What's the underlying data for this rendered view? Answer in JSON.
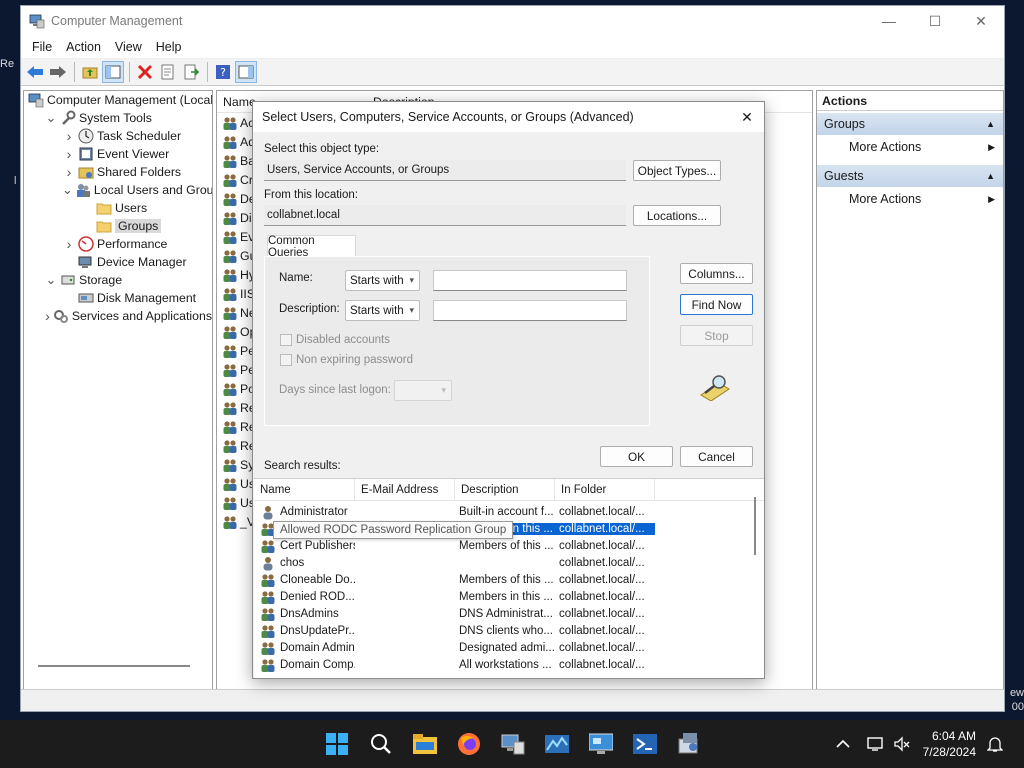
{
  "window": {
    "title": "Computer Management"
  },
  "menu": [
    "File",
    "Action",
    "View",
    "Help"
  ],
  "tree": [
    {
      "label": "Computer Management (Local",
      "level": 0,
      "exp": "",
      "icon": "computer-management-icon",
      "selected": false
    },
    {
      "label": "System Tools",
      "level": 1,
      "exp": "v",
      "icon": "system-tools-icon",
      "selected": false
    },
    {
      "label": "Task Scheduler",
      "level": 2,
      "exp": ">",
      "icon": "clock-icon",
      "selected": false
    },
    {
      "label": "Event Viewer",
      "level": 2,
      "exp": ">",
      "icon": "event-viewer-icon",
      "selected": false
    },
    {
      "label": "Shared Folders",
      "level": 2,
      "exp": ">",
      "icon": "shared-folder-icon",
      "selected": false
    },
    {
      "label": "Local Users and Groups",
      "level": 2,
      "exp": "v",
      "icon": "users-group-icon",
      "selected": false
    },
    {
      "label": "Users",
      "level": 3,
      "exp": "",
      "icon": "folder-icon",
      "selected": false
    },
    {
      "label": "Groups",
      "level": 3,
      "exp": "",
      "icon": "folder-icon",
      "selected": true
    },
    {
      "label": "Performance",
      "level": 2,
      "exp": ">",
      "icon": "performance-icon",
      "selected": false
    },
    {
      "label": "Device Manager",
      "level": 2,
      "exp": "",
      "icon": "device-manager-icon",
      "selected": false
    },
    {
      "label": "Storage",
      "level": 1,
      "exp": "v",
      "icon": "storage-icon",
      "selected": false
    },
    {
      "label": "Disk Management",
      "level": 2,
      "exp": "",
      "icon": "disk-icon",
      "selected": false
    },
    {
      "label": "Services and Applications",
      "level": 1,
      "exp": ">",
      "icon": "services-icon",
      "selected": false
    }
  ],
  "midlist": {
    "columns": [
      "Name",
      "Description"
    ],
    "rows": [
      "Ac",
      "Ad",
      "Ba",
      "Cr",
      "De",
      "Dis",
      "Ev",
      "Gu",
      "Hy",
      "IIS_",
      "Ne",
      "Op",
      "Pe",
      "Pe",
      "Po",
      "Re",
      "Re",
      "Re",
      "Sy",
      "Us",
      "Us",
      "_V"
    ]
  },
  "actions": {
    "title": "Actions",
    "sections": [
      {
        "name": "Groups",
        "item": "More Actions"
      },
      {
        "name": "Guests",
        "item": "More Actions"
      }
    ]
  },
  "dialog": {
    "title": "Select Users, Computers, Service Accounts, or Groups (Advanced)",
    "object_type_label": "Select this object type:",
    "object_type_value": "Users, Service Accounts, or Groups",
    "object_types_button": "Object Types...",
    "location_label": "From this location:",
    "location_value": "collabnet.local",
    "locations_button": "Locations...",
    "tab_label": "Common Queries",
    "name_label": "Name:",
    "name_mode": "Starts with",
    "description_label": "Description:",
    "description_mode": "Starts with",
    "disabled_accounts": "Disabled accounts",
    "non_expiring": "Non expiring password",
    "days_since_logon": "Days since last logon:",
    "columns_button": "Columns...",
    "find_now_button": "Find Now",
    "stop_button": "Stop",
    "ok_button": "OK",
    "cancel_button": "Cancel",
    "search_results_label": "Search results:",
    "results_columns": [
      "Name",
      "E-Mail Address",
      "Description",
      "In Folder"
    ],
    "results": [
      {
        "name": "Administrator",
        "email": "",
        "description": "Built-in account f...",
        "folder": "collabnet.local/...",
        "icon": "user-icon",
        "selected": false
      },
      {
        "name": "Allowed RO...",
        "email": "",
        "description": "Members in this ...",
        "folder": "collabnet.local/...",
        "icon": "group-icon",
        "selected": true
      },
      {
        "name": "Cert Publishers",
        "email": "",
        "description": "Members of this ...",
        "folder": "collabnet.local/...",
        "icon": "group-icon",
        "selected": false
      },
      {
        "name": "chos",
        "email": "",
        "description": "",
        "folder": "collabnet.local/...",
        "icon": "user-icon",
        "selected": false
      },
      {
        "name": "Cloneable Do...",
        "email": "",
        "description": "Members of this ...",
        "folder": "collabnet.local/...",
        "icon": "group-icon",
        "selected": false
      },
      {
        "name": "Denied ROD...",
        "email": "",
        "description": "Members in this ...",
        "folder": "collabnet.local/...",
        "icon": "group-icon",
        "selected": false
      },
      {
        "name": "DnsAdmins",
        "email": "",
        "description": "DNS Administrat...",
        "folder": "collabnet.local/...",
        "icon": "group-icon",
        "selected": false
      },
      {
        "name": "DnsUpdatePr...",
        "email": "",
        "description": "DNS clients who...",
        "folder": "collabnet.local/...",
        "icon": "group-icon",
        "selected": false
      },
      {
        "name": "Domain Admins",
        "email": "",
        "description": "Designated admi...",
        "folder": "collabnet.local/...",
        "icon": "group-icon",
        "selected": false
      },
      {
        "name": "Domain Comp...",
        "email": "",
        "description": "All workstations ...",
        "folder": "collabnet.local/...",
        "icon": "group-icon",
        "selected": false
      }
    ],
    "tooltip": "Allowed RODC Password Replication Group"
  },
  "taskbar": {
    "time": "6:04 AM",
    "date": "7/28/2024"
  },
  "desktop": {
    "peek_left": "Re",
    "peek_left2": "l",
    "peek_right1": "ew",
    "peek_right2": "00"
  },
  "colors": {
    "selection": "#0a64d2",
    "action_header": "#c9d9ec",
    "taskbar": "#1c1c1c"
  }
}
